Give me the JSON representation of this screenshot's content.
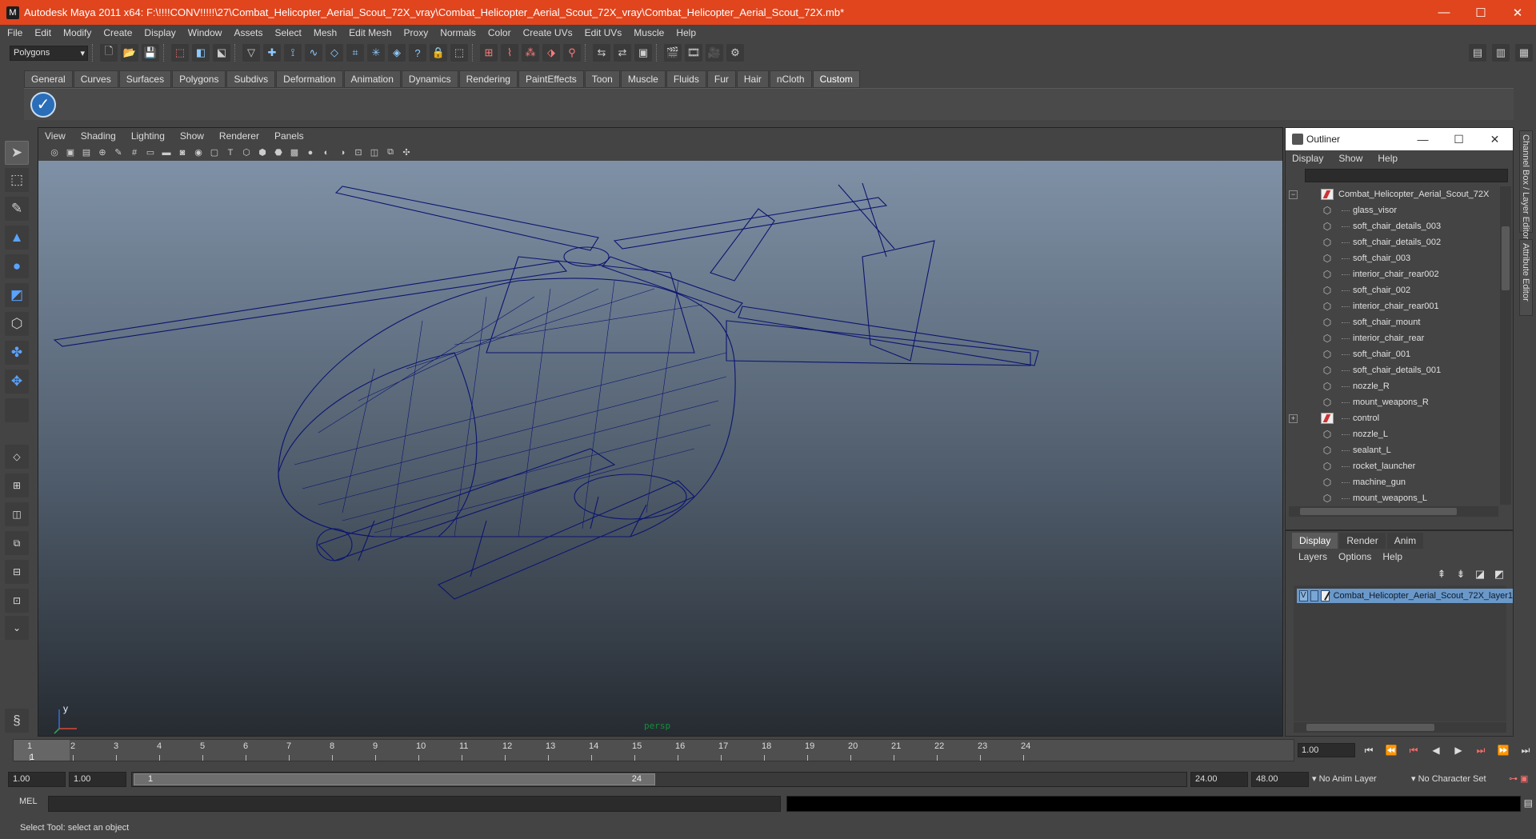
{
  "window": {
    "title": "Autodesk Maya 2011 x64: F:\\!!!!CONV!!!!!\\27\\Combat_Helicopter_Aerial_Scout_72X_vray\\Combat_Helicopter_Aerial_Scout_72X_vray\\Combat_Helicopter_Aerial_Scout_72X.mb*",
    "controls": [
      "—",
      "☐",
      "✕"
    ]
  },
  "menubar": [
    "File",
    "Edit",
    "Modify",
    "Create",
    "Display",
    "Window",
    "Assets",
    "Select",
    "Mesh",
    "Edit Mesh",
    "Proxy",
    "Normals",
    "Color",
    "Create UVs",
    "Edit UVs",
    "Muscle",
    "Help"
  ],
  "statusline": {
    "mode": "Polygons"
  },
  "shelf": {
    "tabs": [
      "General",
      "Curves",
      "Surfaces",
      "Polygons",
      "Subdivs",
      "Deformation",
      "Animation",
      "Dynamics",
      "Rendering",
      "PaintEffects",
      "Toon",
      "Muscle",
      "Fluids",
      "Fur",
      "Hair",
      "nCloth",
      "Custom"
    ],
    "active_tab": "Custom",
    "icon": "checkmark-icon"
  },
  "viewport": {
    "menus": [
      "View",
      "Shading",
      "Lighting",
      "Show",
      "Renderer",
      "Panels"
    ],
    "camera": "persp",
    "axis": {
      "y": "y"
    },
    "wire_color": "#0c1470"
  },
  "outliner": {
    "title": "Outliner",
    "menus": [
      "Display",
      "Show",
      "Help"
    ],
    "items": [
      {
        "label": "Combat_Helicopter_Aerial_Scout_72X",
        "type": "group",
        "expand": "−"
      },
      {
        "label": "glass_visor",
        "type": "mesh"
      },
      {
        "label": "soft_chair_details_003",
        "type": "mesh"
      },
      {
        "label": "soft_chair_details_002",
        "type": "mesh"
      },
      {
        "label": "soft_chair_003",
        "type": "mesh"
      },
      {
        "label": "interior_chair_rear002",
        "type": "mesh"
      },
      {
        "label": "soft_chair_002",
        "type": "mesh"
      },
      {
        "label": "interior_chair_rear001",
        "type": "mesh"
      },
      {
        "label": "soft_chair_mount",
        "type": "mesh"
      },
      {
        "label": "interior_chair_rear",
        "type": "mesh"
      },
      {
        "label": "soft_chair_001",
        "type": "mesh"
      },
      {
        "label": "soft_chair_details_001",
        "type": "mesh"
      },
      {
        "label": "nozzle_R",
        "type": "mesh"
      },
      {
        "label": "mount_weapons_R",
        "type": "mesh"
      },
      {
        "label": "control",
        "type": "group",
        "expand": "+"
      },
      {
        "label": "nozzle_L",
        "type": "mesh"
      },
      {
        "label": "sealant_L",
        "type": "mesh"
      },
      {
        "label": "rocket_launcher",
        "type": "mesh"
      },
      {
        "label": "machine_gun",
        "type": "mesh"
      },
      {
        "label": "mount_weapons_L",
        "type": "mesh"
      }
    ]
  },
  "side_tabs": [
    "Channel Box / Layer Editor",
    "Attribute Editor"
  ],
  "layer_editor": {
    "tabs": [
      "Display",
      "Render",
      "Anim"
    ],
    "active_tab": "Display",
    "menus": [
      "Layers",
      "Options",
      "Help"
    ],
    "layer": {
      "visible": "V",
      "name": "Combat_Helicopter_Aerial_Scout_72X_layer1"
    }
  },
  "timeline": {
    "ticks": [
      "1",
      "2",
      "3",
      "4",
      "5",
      "6",
      "7",
      "8",
      "9",
      "10",
      "11",
      "12",
      "13",
      "14",
      "15",
      "16",
      "17",
      "18",
      "19",
      "20",
      "21",
      "22",
      "23",
      "24"
    ],
    "current_frame": "1",
    "current_time": "1.00",
    "controls": [
      "⏮",
      "⏪",
      "⏮",
      "◀",
      "▶",
      "⏭",
      "⏩",
      "⏭"
    ]
  },
  "range": {
    "start": "1.00",
    "playback_start": "1.00",
    "bar_start": "1",
    "bar_end": "24",
    "playback_end": "24.00",
    "end": "48.00",
    "anim_layer": "No Anim Layer",
    "character_set": "No Character Set"
  },
  "command": {
    "label": "MEL"
  },
  "help": {
    "text": "Select Tool: select an object"
  }
}
